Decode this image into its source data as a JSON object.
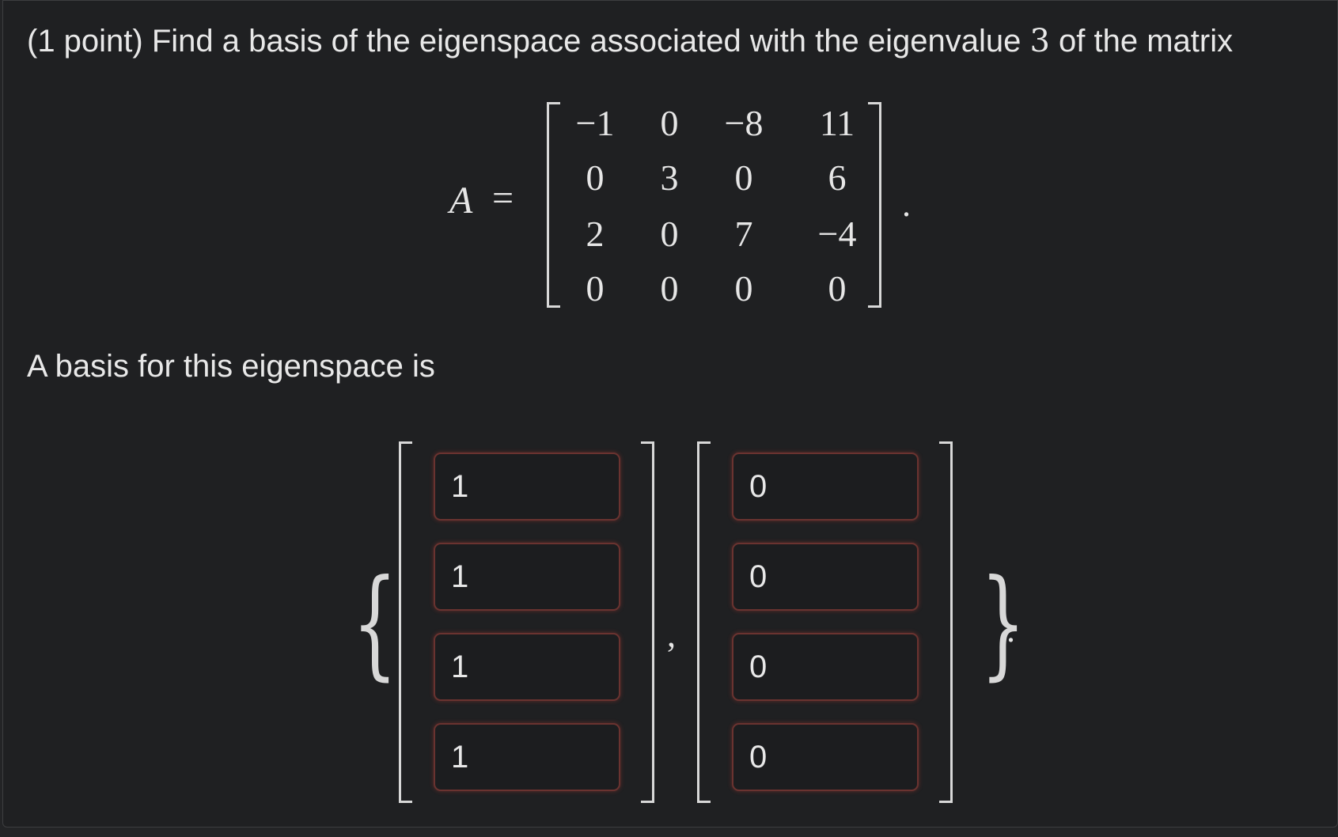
{
  "question": {
    "prefix": "(1 point) Find a basis of the eigenspace associated with the eigenvalue ",
    "eigenvalue": "3",
    "suffix": " of the matrix"
  },
  "matrix": {
    "label": "A",
    "equals": "=",
    "rows": [
      [
        "−1",
        "0",
        "−8",
        "11"
      ],
      [
        "0",
        "3",
        "0",
        "6"
      ],
      [
        "2",
        "0",
        "7",
        "−4"
      ],
      [
        "0",
        "0",
        "0",
        "0"
      ]
    ],
    "trailing": "."
  },
  "answer": {
    "label": "A basis for this eigenspace is",
    "open_brace": "{",
    "close_brace": "}",
    "separator": ",",
    "trailing": ".",
    "vectors": [
      [
        "1",
        "1",
        "1",
        "1"
      ],
      [
        "0",
        "0",
        "0",
        "0"
      ]
    ]
  },
  "colors": {
    "background": "#1f2022",
    "text": "#e8e8e8",
    "input_border_error": "#6a3330"
  }
}
